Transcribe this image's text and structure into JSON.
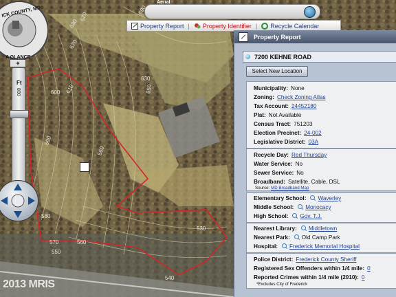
{
  "map": {
    "badge_top": "ICK COUNTY, MD",
    "badge_bottom": "A GLANCE",
    "aerial_label": "Aerial",
    "scale_label": "Ft",
    "scale_value": "800",
    "watermark": "2013 MRIS",
    "contour_labels": [
      "600",
      "610",
      "590",
      "580",
      "570",
      "560",
      "540",
      "550",
      "530",
      "630",
      "650",
      "670",
      "680",
      "560",
      "620",
      "690"
    ]
  },
  "tabs": [
    {
      "label": "Property Report",
      "icon": "report-icon"
    },
    {
      "label": "Property Identifier",
      "icon": "identifier-icon"
    },
    {
      "label": "Recycle Calendar",
      "icon": "recycle-icon"
    }
  ],
  "panel": {
    "title": "Property Report",
    "address": "7200   KEHNE ROAD",
    "select_button": "Select New Location",
    "s1": {
      "municipality_label": "Municipality:",
      "municipality": "None",
      "zoning_label": "Zoning:",
      "zoning": "Check Zoning Atlas",
      "tax_label": "Tax Account:",
      "tax": "24452180",
      "plat_label": "Plat:",
      "plat": "Not Available",
      "census_label": "Census Tract:",
      "census": "751203",
      "precinct_label": "Election Precinct:",
      "precinct": "24-002",
      "district_label": "Legislative District:",
      "district": "03A"
    },
    "s2": {
      "recycle_label": "Recycle Day:",
      "recycle": "Red Thursday",
      "water_label": "Water Service:",
      "water": "No",
      "sewer_label": "Sewer Service:",
      "sewer": "No",
      "broadband_label": "Broadband:",
      "broadband": "Satellite, Cable, DSL",
      "source_label": "Source:",
      "source": "MD Broadband Map"
    },
    "s3": {
      "elem_label": "Elementary School:",
      "elem": "Waverley",
      "middle_label": "Middle School:",
      "middle": "Monocacy",
      "high_label": "High School:",
      "high": "Gov. T.J."
    },
    "s4": {
      "library_label": "Nearest Library:",
      "library": "Middletown",
      "park_label": "Nearest Park:",
      "park": "Old Camp Park",
      "hospital_label": "Hospital:",
      "hospital": "Frederick Memorial Hospital"
    },
    "s5": {
      "police_label": "Police District:",
      "police": "Frederick County Sheriff",
      "offenders_label": "Registered Sex Offenders within 1/4 mile:",
      "offenders": "0",
      "crimes_label": "Reported Crimes within 1/4 mile (2010):",
      "crimes": "0",
      "note": "*Excludes City of Frederick"
    }
  },
  "colors": {
    "accent": "#23408f",
    "parcel": "#d4252a",
    "panel": "#b7c3d3"
  }
}
